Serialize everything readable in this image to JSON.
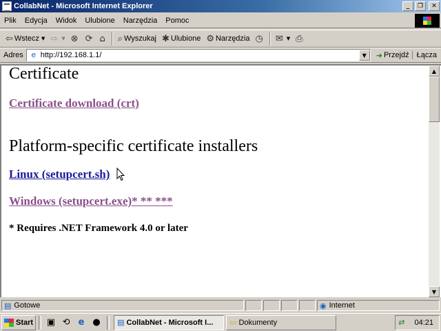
{
  "window": {
    "title": "CollabNet - Microsoft Internet Explorer",
    "buttons": {
      "minimize": "_",
      "maximize": "❐",
      "close": "✕"
    }
  },
  "menubar": {
    "items": [
      "Plik",
      "Edycja",
      "Widok",
      "Ulubione",
      "Narzędzia",
      "Pomoc"
    ]
  },
  "toolbar": {
    "back": "Wstecz",
    "search": "Wyszukaj",
    "favorites": "Ulubione",
    "tools": "Narzędzia"
  },
  "address": {
    "label": "Adres",
    "url": "http://192.168.1.1/",
    "go": "Przejdź",
    "links": "Łącza"
  },
  "page": {
    "heading_certificate": "Certificate",
    "link_crt": "Certificate download (crt)",
    "heading_platform": "Platform-specific certificate installers",
    "link_linux": "Linux (setupcert.sh)",
    "link_windows": "Windows (setupcert.exe)* ** ***",
    "note": "* Requires .NET Framework 4.0 or later"
  },
  "status": {
    "text": "Gotowe",
    "zone": "Internet"
  },
  "taskbar": {
    "start": "Start",
    "tasks": [
      "CollabNet - Microsoft I...",
      "Dokumenty"
    ],
    "clock": "04:21"
  },
  "colors": {
    "title_start": "#0a246a",
    "visited_link": "#8a4f8a",
    "unvisited_link": "#1a1a9a",
    "chrome": "#d4d0c8"
  }
}
